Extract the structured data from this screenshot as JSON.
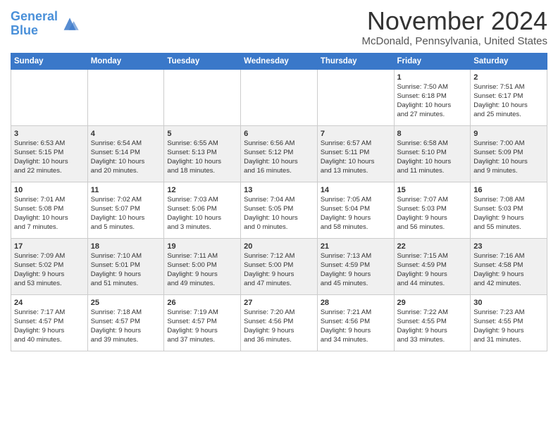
{
  "logo": {
    "line1": "General",
    "line2": "Blue"
  },
  "title": "November 2024",
  "location": "McDonald, Pennsylvania, United States",
  "days_header": [
    "Sunday",
    "Monday",
    "Tuesday",
    "Wednesday",
    "Thursday",
    "Friday",
    "Saturday"
  ],
  "weeks": [
    [
      {
        "day": "",
        "info": ""
      },
      {
        "day": "",
        "info": ""
      },
      {
        "day": "",
        "info": ""
      },
      {
        "day": "",
        "info": ""
      },
      {
        "day": "",
        "info": ""
      },
      {
        "day": "1",
        "info": "Sunrise: 7:50 AM\nSunset: 6:18 PM\nDaylight: 10 hours\nand 27 minutes."
      },
      {
        "day": "2",
        "info": "Sunrise: 7:51 AM\nSunset: 6:17 PM\nDaylight: 10 hours\nand 25 minutes."
      }
    ],
    [
      {
        "day": "3",
        "info": "Sunrise: 6:53 AM\nSunset: 5:15 PM\nDaylight: 10 hours\nand 22 minutes."
      },
      {
        "day": "4",
        "info": "Sunrise: 6:54 AM\nSunset: 5:14 PM\nDaylight: 10 hours\nand 20 minutes."
      },
      {
        "day": "5",
        "info": "Sunrise: 6:55 AM\nSunset: 5:13 PM\nDaylight: 10 hours\nand 18 minutes."
      },
      {
        "day": "6",
        "info": "Sunrise: 6:56 AM\nSunset: 5:12 PM\nDaylight: 10 hours\nand 16 minutes."
      },
      {
        "day": "7",
        "info": "Sunrise: 6:57 AM\nSunset: 5:11 PM\nDaylight: 10 hours\nand 13 minutes."
      },
      {
        "day": "8",
        "info": "Sunrise: 6:58 AM\nSunset: 5:10 PM\nDaylight: 10 hours\nand 11 minutes."
      },
      {
        "day": "9",
        "info": "Sunrise: 7:00 AM\nSunset: 5:09 PM\nDaylight: 10 hours\nand 9 minutes."
      }
    ],
    [
      {
        "day": "10",
        "info": "Sunrise: 7:01 AM\nSunset: 5:08 PM\nDaylight: 10 hours\nand 7 minutes."
      },
      {
        "day": "11",
        "info": "Sunrise: 7:02 AM\nSunset: 5:07 PM\nDaylight: 10 hours\nand 5 minutes."
      },
      {
        "day": "12",
        "info": "Sunrise: 7:03 AM\nSunset: 5:06 PM\nDaylight: 10 hours\nand 3 minutes."
      },
      {
        "day": "13",
        "info": "Sunrise: 7:04 AM\nSunset: 5:05 PM\nDaylight: 10 hours\nand 0 minutes."
      },
      {
        "day": "14",
        "info": "Sunrise: 7:05 AM\nSunset: 5:04 PM\nDaylight: 9 hours\nand 58 minutes."
      },
      {
        "day": "15",
        "info": "Sunrise: 7:07 AM\nSunset: 5:03 PM\nDaylight: 9 hours\nand 56 minutes."
      },
      {
        "day": "16",
        "info": "Sunrise: 7:08 AM\nSunset: 5:03 PM\nDaylight: 9 hours\nand 55 minutes."
      }
    ],
    [
      {
        "day": "17",
        "info": "Sunrise: 7:09 AM\nSunset: 5:02 PM\nDaylight: 9 hours\nand 53 minutes."
      },
      {
        "day": "18",
        "info": "Sunrise: 7:10 AM\nSunset: 5:01 PM\nDaylight: 9 hours\nand 51 minutes."
      },
      {
        "day": "19",
        "info": "Sunrise: 7:11 AM\nSunset: 5:00 PM\nDaylight: 9 hours\nand 49 minutes."
      },
      {
        "day": "20",
        "info": "Sunrise: 7:12 AM\nSunset: 5:00 PM\nDaylight: 9 hours\nand 47 minutes."
      },
      {
        "day": "21",
        "info": "Sunrise: 7:13 AM\nSunset: 4:59 PM\nDaylight: 9 hours\nand 45 minutes."
      },
      {
        "day": "22",
        "info": "Sunrise: 7:15 AM\nSunset: 4:59 PM\nDaylight: 9 hours\nand 44 minutes."
      },
      {
        "day": "23",
        "info": "Sunrise: 7:16 AM\nSunset: 4:58 PM\nDaylight: 9 hours\nand 42 minutes."
      }
    ],
    [
      {
        "day": "24",
        "info": "Sunrise: 7:17 AM\nSunset: 4:57 PM\nDaylight: 9 hours\nand 40 minutes."
      },
      {
        "day": "25",
        "info": "Sunrise: 7:18 AM\nSunset: 4:57 PM\nDaylight: 9 hours\nand 39 minutes."
      },
      {
        "day": "26",
        "info": "Sunrise: 7:19 AM\nSunset: 4:57 PM\nDaylight: 9 hours\nand 37 minutes."
      },
      {
        "day": "27",
        "info": "Sunrise: 7:20 AM\nSunset: 4:56 PM\nDaylight: 9 hours\nand 36 minutes."
      },
      {
        "day": "28",
        "info": "Sunrise: 7:21 AM\nSunset: 4:56 PM\nDaylight: 9 hours\nand 34 minutes."
      },
      {
        "day": "29",
        "info": "Sunrise: 7:22 AM\nSunset: 4:55 PM\nDaylight: 9 hours\nand 33 minutes."
      },
      {
        "day": "30",
        "info": "Sunrise: 7:23 AM\nSunset: 4:55 PM\nDaylight: 9 hours\nand 31 minutes."
      }
    ]
  ]
}
